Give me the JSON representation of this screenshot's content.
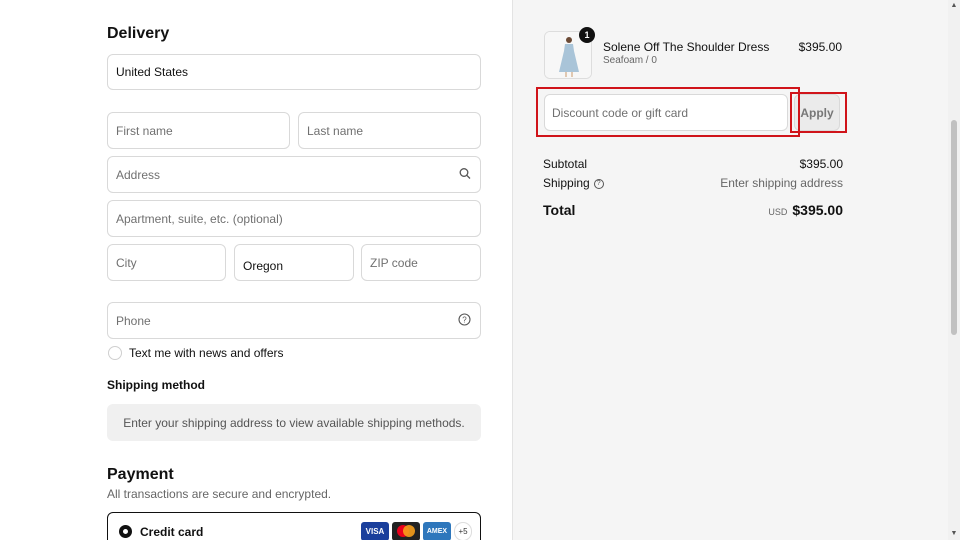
{
  "delivery": {
    "heading": "Delivery",
    "country_value": "United States",
    "first_name_placeholder": "First name",
    "last_name_placeholder": "Last name",
    "address_placeholder": "Address",
    "apartment_placeholder": "Apartment, suite, etc. (optional)",
    "city_placeholder": "City",
    "state_value": "Oregon",
    "zip_placeholder": "ZIP code",
    "phone_placeholder": "Phone",
    "news_opt_in_label": "Text me with news and offers"
  },
  "shipping_method": {
    "heading": "Shipping method",
    "message": "Enter your shipping address to view available shipping methods."
  },
  "payment": {
    "heading": "Payment",
    "subtitle": "All transactions are secure and encrypted.",
    "credit_card_label": "Credit card",
    "card_brands": [
      "VISA",
      "AMEX"
    ],
    "more_cards": "+5"
  },
  "order_summary": {
    "quantity_badge": "1",
    "product_name": "Solene Off The Shoulder Dress",
    "product_variant": "Seafoam / 0",
    "product_price": "$395.00",
    "discount_placeholder": "Discount code or gift card",
    "apply_label": "Apply",
    "subtotal_label": "Subtotal",
    "subtotal_value": "$395.00",
    "shipping_label": "Shipping",
    "shipping_value": "Enter shipping address",
    "total_label": "Total",
    "currency": "USD",
    "total_value": "$395.00"
  },
  "colors": {
    "highlight": "#d0141a",
    "summary_bg": "#f5f5f5"
  }
}
